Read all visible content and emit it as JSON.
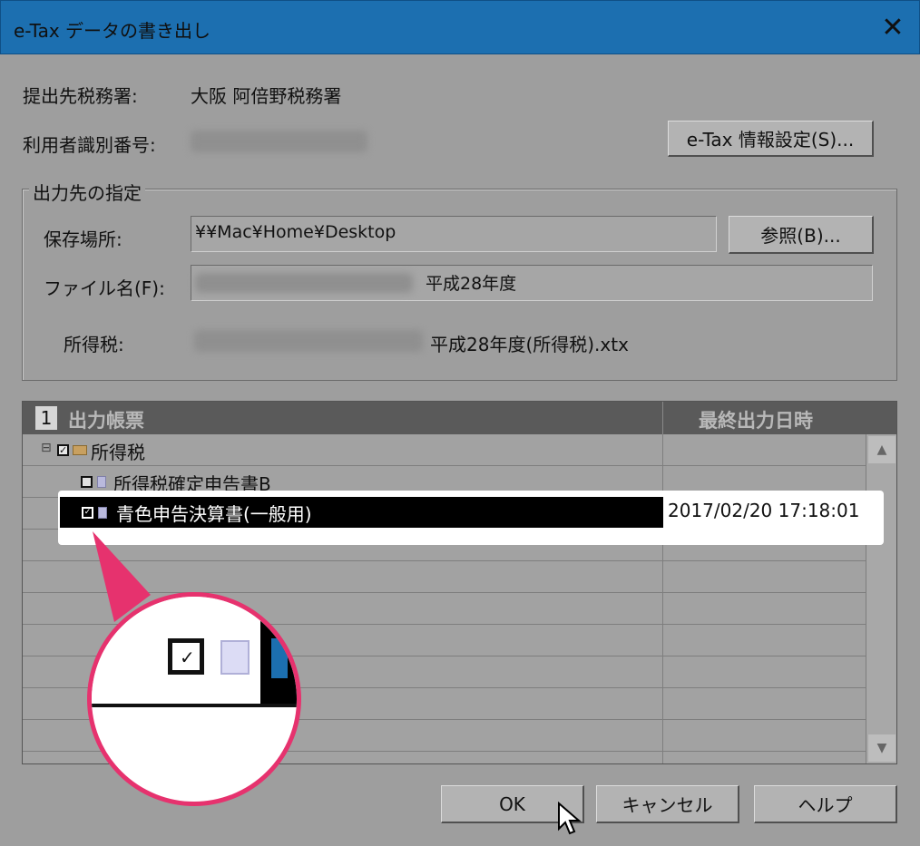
{
  "window": {
    "title": "e-Tax データの書き出し",
    "close_glyph": "✕"
  },
  "info": {
    "office_label": "提出先税務署:",
    "office_value": "大阪 阿倍野税務署",
    "user_id_label": "利用者識別番号:",
    "etax_settings_button": "e-Tax 情報設定(S)..."
  },
  "output": {
    "group_title": "出力先の指定",
    "location_label": "保存場所:",
    "location_value": "¥¥Mac¥Home¥Desktop",
    "browse_button": "参照(B)...",
    "filename_label": "ファイル名(F):",
    "filename_value": "平成28年度",
    "income_tax_label": "所得税:",
    "income_tax_file": "平成28年度(所得税).xtx"
  },
  "grid": {
    "header_number": "1",
    "col_forms": "出力帳票",
    "col_last_output": "最終出力日時",
    "rows": [
      {
        "label": "所得税",
        "date": "",
        "expand": "⊟",
        "checked": true
      },
      {
        "label": "所得税確定申告書B",
        "date": "",
        "checked": false
      },
      {
        "label": "青色申告決算書(一般用)",
        "date": "2017/02/20 17:18:01",
        "checked": true
      }
    ]
  },
  "footer": {
    "ok_button": "OK",
    "cancel_button": "キャンセル",
    "help_button": "ヘルプ"
  },
  "colors": {
    "titlebar": "#1c6fb0",
    "callout_accent": "#e6326e"
  }
}
